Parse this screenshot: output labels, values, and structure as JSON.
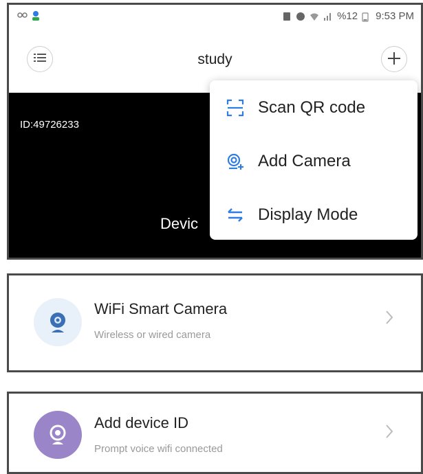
{
  "status_bar": {
    "time": "9:53 PM",
    "battery_text": "%12",
    "left_icons": [
      "notification-icon",
      "person-icon"
    ],
    "right_icons": [
      "sim-icon",
      "alarm-icon",
      "wifi-icon",
      "signal-icon",
      "battery-icon"
    ]
  },
  "header": {
    "title": "study",
    "menu_icon": "list-icon",
    "add_icon": "plus-icon"
  },
  "video": {
    "device_id": "ID:49726233",
    "status_text": "Devic"
  },
  "dropdown": {
    "items": [
      {
        "label": "Scan QR code",
        "icon": "scan-qr-icon"
      },
      {
        "label": "Add Camera",
        "icon": "add-camera-icon"
      },
      {
        "label": "Display Mode",
        "icon": "display-mode-icon"
      }
    ]
  },
  "cards": [
    {
      "title": "WiFi Smart Camera",
      "subtitle": "Wireless or wired camera",
      "icon": "camera-icon"
    },
    {
      "title": "Add device ID",
      "subtitle": "Prompt voice wifi connected",
      "icon": "device-id-icon"
    }
  ],
  "colors": {
    "accent": "#2f7de1",
    "device_id_bg": "#9a85c8",
    "camera_bg": "#e8f0fa"
  }
}
